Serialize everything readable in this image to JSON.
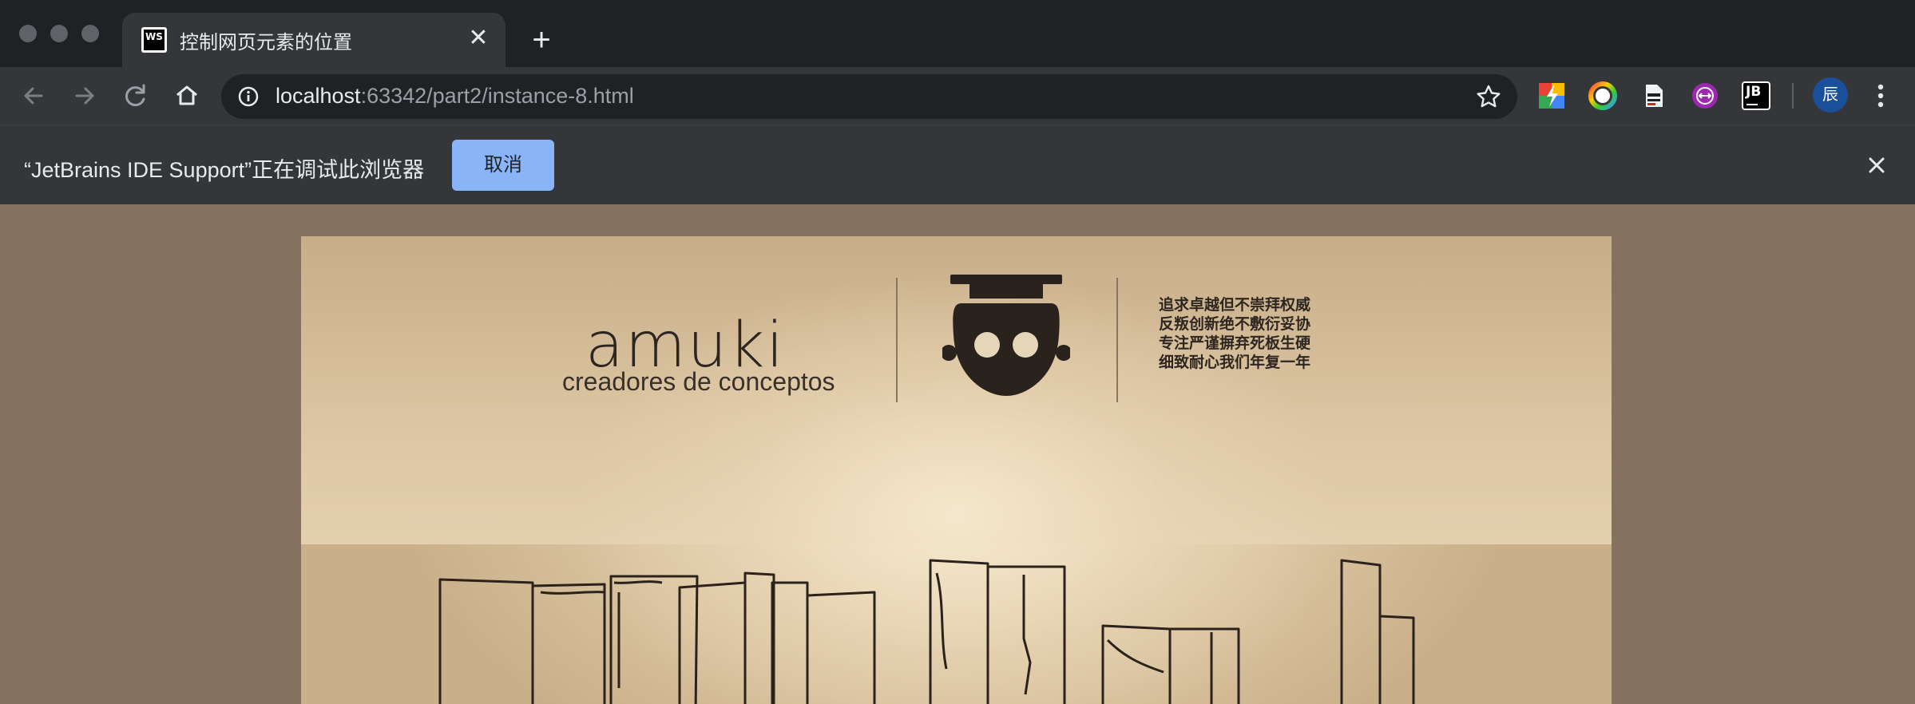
{
  "browser": {
    "tab": {
      "favicon_text": "WS",
      "title": "控制网页元素的位置",
      "close_glyph": "✕"
    },
    "new_tab_glyph": "+",
    "omnibox": {
      "host": "localhost",
      "path": ":63342/part2/instance-8.html"
    },
    "extensions": [
      "lightning-icon",
      "color-picker-icon",
      "spy-icon",
      "vpn-icon",
      "jetbrains-icon"
    ],
    "extension_jb_text": "JB",
    "avatar_text": "辰"
  },
  "infobar": {
    "message": "“JetBrains IDE Support”正在调试此浏览器",
    "cancel_label": "取消"
  },
  "page": {
    "brand": {
      "wordmark": "amuki",
      "tagline": "creadores de conceptos"
    },
    "slogan": [
      "追求卓越但不崇拜权威",
      "反叛创新绝不敷衍妥协",
      "专注严谨摒弃死板生硬",
      "细致耐心我们年复一年"
    ]
  },
  "colors": {
    "tabstrip_bg": "#202124",
    "toolbar_bg": "#35363a",
    "button_blue": "#8ab4f8",
    "page_bg": "#85725e",
    "ink": "#2d2520"
  }
}
